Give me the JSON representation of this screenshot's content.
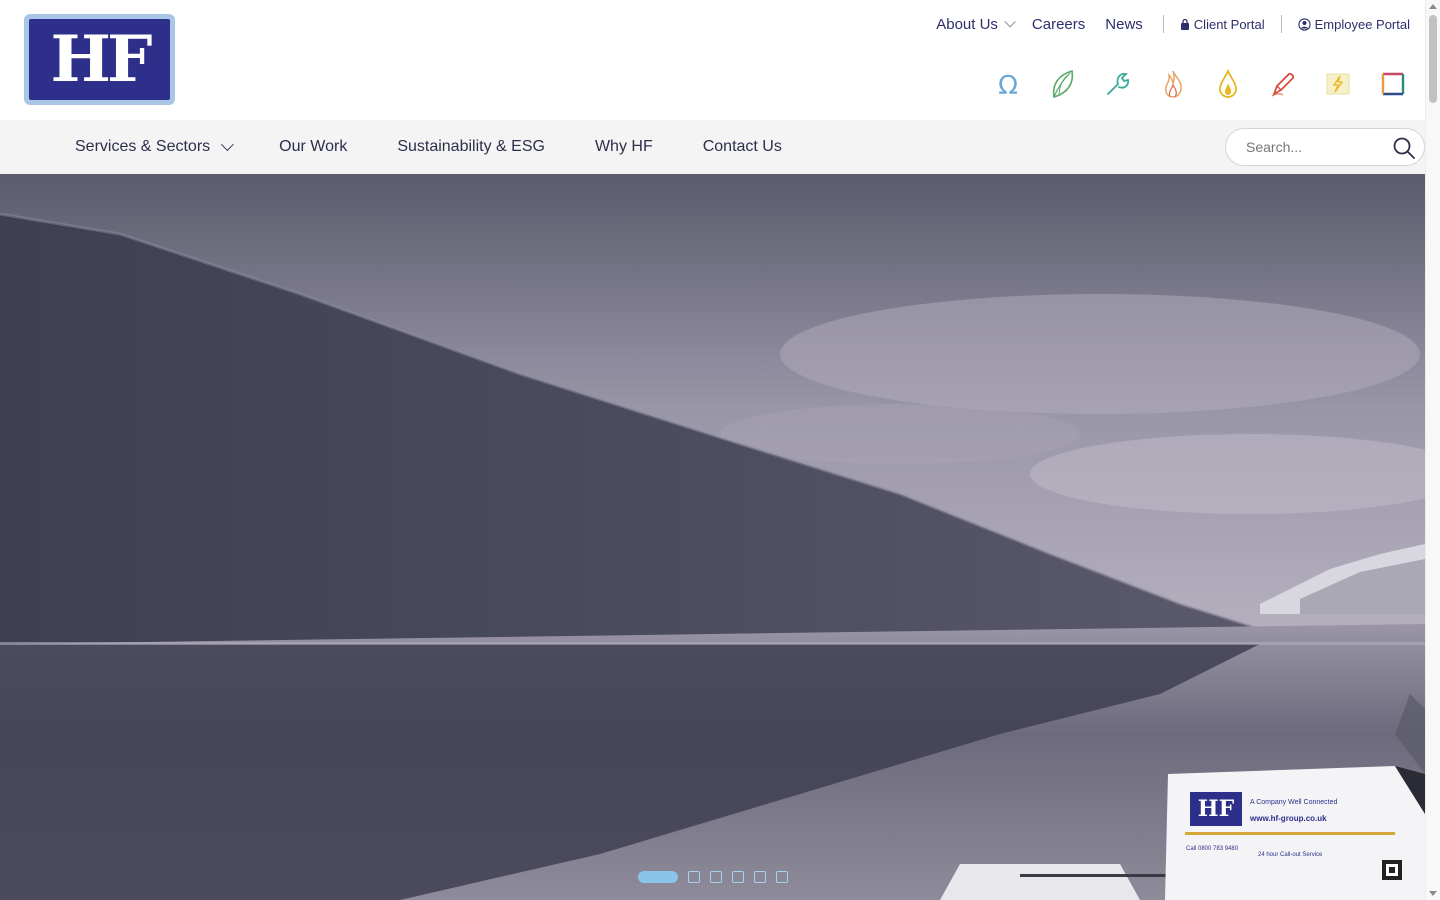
{
  "logo": {
    "text": "HF",
    "bg_color": "#2d2f8b",
    "border_color": "#a9c6e6"
  },
  "utility_nav": {
    "about_label": "About Us",
    "careers_label": "Careers",
    "news_label": "News",
    "client_portal_label": "Client Portal",
    "employee_portal_label": "Employee Portal"
  },
  "sector_icons": [
    {
      "name": "omega-icon",
      "color": "#6aa8d4"
    },
    {
      "name": "leaf-icon",
      "color": "#58a868"
    },
    {
      "name": "wrench-icon",
      "color": "#3aa89a"
    },
    {
      "name": "flame-icon",
      "color": "#e8a468"
    },
    {
      "name": "fire-drop-icon",
      "color": "#e8b820"
    },
    {
      "name": "pen-icon",
      "color": "#d84838"
    },
    {
      "name": "lightning-icon",
      "color": "#e8d070"
    },
    {
      "name": "square-icon",
      "color": "#c84868"
    }
  ],
  "main_nav": {
    "items": [
      {
        "label": "Services & Sectors"
      },
      {
        "label": "Our Work"
      },
      {
        "label": "Sustainability & ESG"
      },
      {
        "label": "Why HF"
      },
      {
        "label": "Contact Us"
      }
    ]
  },
  "search": {
    "placeholder": "Search..."
  },
  "hero": {
    "van_logo": "HF",
    "van_tagline": "A Company Well Connected",
    "van_website": "www.hf-group.co.uk",
    "van_phone": "Call 0800 783 9480",
    "van_service": "24 hour Call-out Service",
    "slides_total": 6,
    "active_slide": 1
  },
  "colors": {
    "brand_navy": "#2d2f8b",
    "accent_blue": "#8bc4ea",
    "nav_bg": "#f4f4f4"
  }
}
